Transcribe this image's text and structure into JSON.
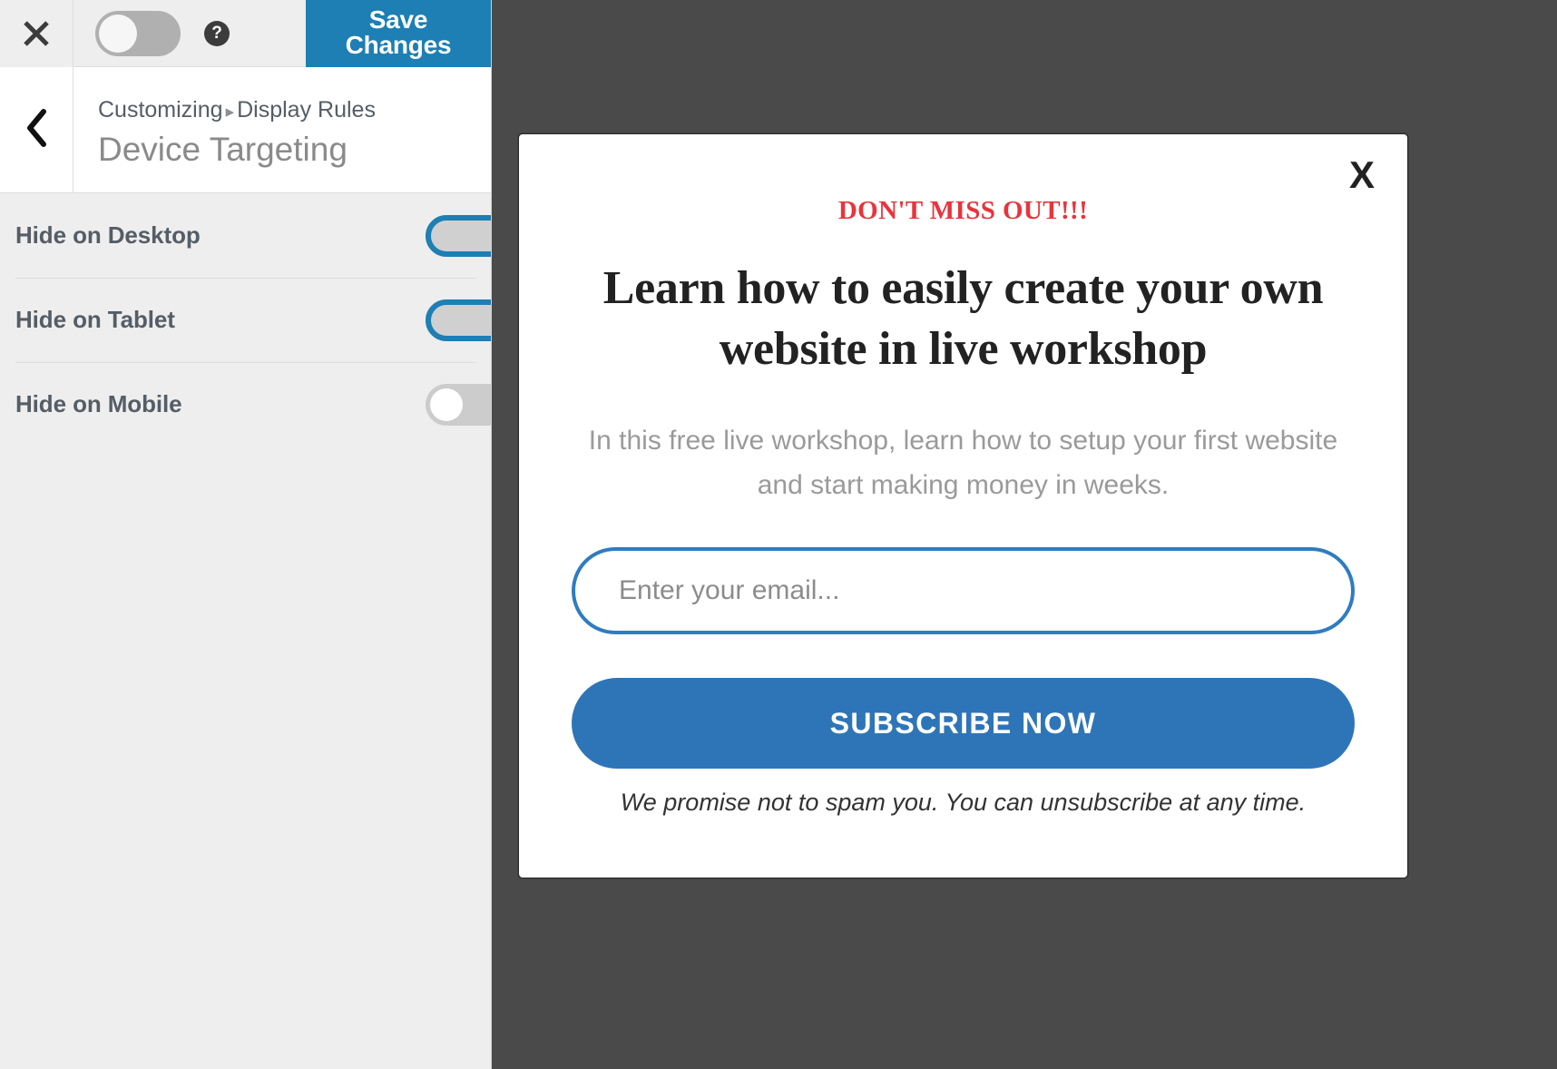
{
  "customizer": {
    "close_icon": "close-x-icon",
    "preview_toggle": {
      "name": "preview-device-toggle",
      "state": "off"
    },
    "help_icon": "help-question-icon",
    "help_glyph": "?",
    "save_label": "Save Changes",
    "back_icon": "chevron-left-icon",
    "breadcrumb": {
      "root": "Customizing",
      "separator": "▸",
      "current": "Display Rules"
    },
    "panel_title": "Device Targeting",
    "rows": [
      {
        "label": "Hide on Desktop",
        "state": "on"
      },
      {
        "label": "Hide on Tablet",
        "state": "on"
      },
      {
        "label": "Hide on Mobile",
        "state": "off"
      }
    ]
  },
  "preview": {
    "background_color": "#4a4a4a",
    "modal": {
      "close_label": "X",
      "eyebrow": "DON'T MISS OUT!!!",
      "headline": "Learn how to easily create your own website in live workshop",
      "subhead": "In this free live workshop, learn how to setup your first website and start making money in weeks.",
      "email_placeholder": "Enter your email...",
      "email_value": "",
      "subscribe_label": "SUBSCRIBE NOW",
      "promise": "We promise not to spam you. You can unsubscribe at any time."
    }
  },
  "colors": {
    "accent_blue": "#1d7fb3",
    "button_blue": "#2e75b8",
    "input_border_blue": "#2f7cc0",
    "alert_red": "#e8343c",
    "panel_bg": "#eeeeee",
    "label_gray": "#555d66"
  }
}
